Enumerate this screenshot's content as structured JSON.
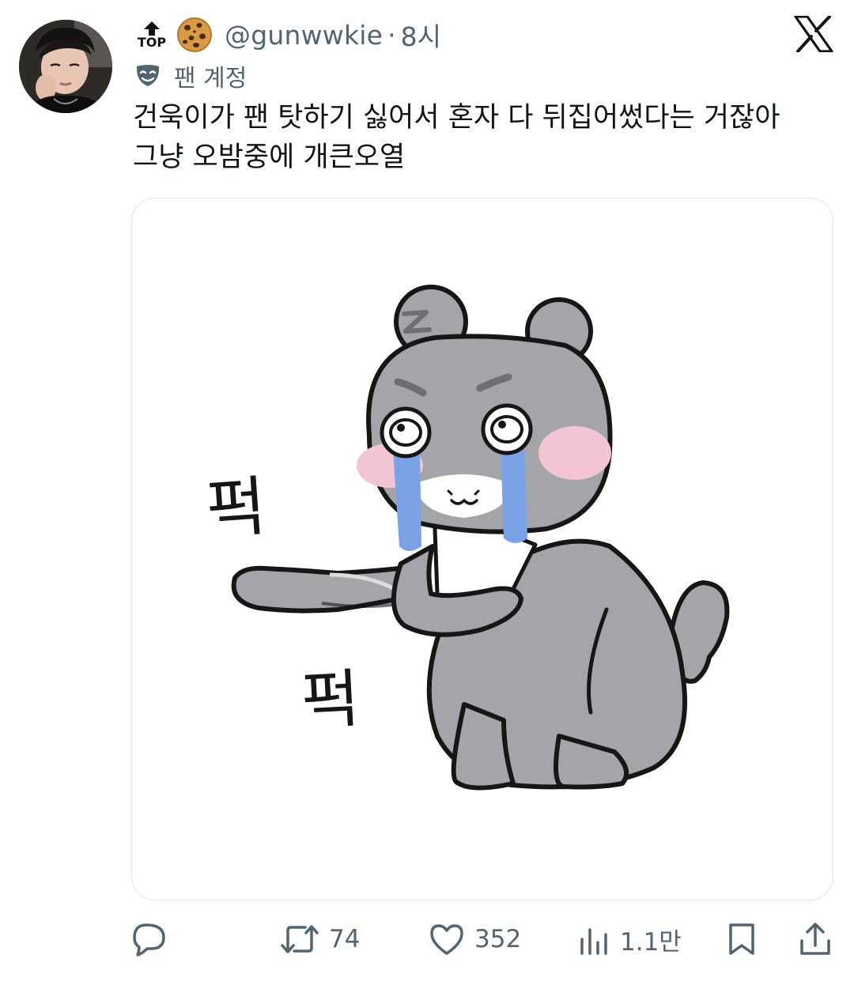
{
  "author": {
    "top_badge": "TOP",
    "badge_icon": "cookie-icon",
    "handle": "@gunwwkie",
    "separator": "·",
    "time": "8시",
    "account_label": "팬 계정",
    "account_icon": "theater-mask-icon"
  },
  "brand": {
    "logo": "x-logo-icon"
  },
  "tweet": {
    "lines": [
      "건욱이가 팬 탓하기 싫어서 혼자 다 뒤집어썼다는 거잖아",
      "그냥 오밤중에 개큰오열"
    ]
  },
  "media": {
    "sfx_top": "퍽",
    "sfx_bottom": "퍽"
  },
  "actions": {
    "reply_icon": "reply-icon",
    "retweet_icon": "retweet-icon",
    "retweet_count": "74",
    "like_icon": "heart-icon",
    "like_count": "352",
    "views_icon": "views-icon",
    "views_count": "1.1만",
    "bookmark_icon": "bookmark-icon",
    "share_icon": "share-icon"
  },
  "colors": {
    "text": "#0f1419",
    "secondary": "#536471",
    "border": "#e1e6ea",
    "character_gray": "#a3a5a8",
    "blush": "#f2c4d4",
    "tears": "#7aa2e6"
  }
}
